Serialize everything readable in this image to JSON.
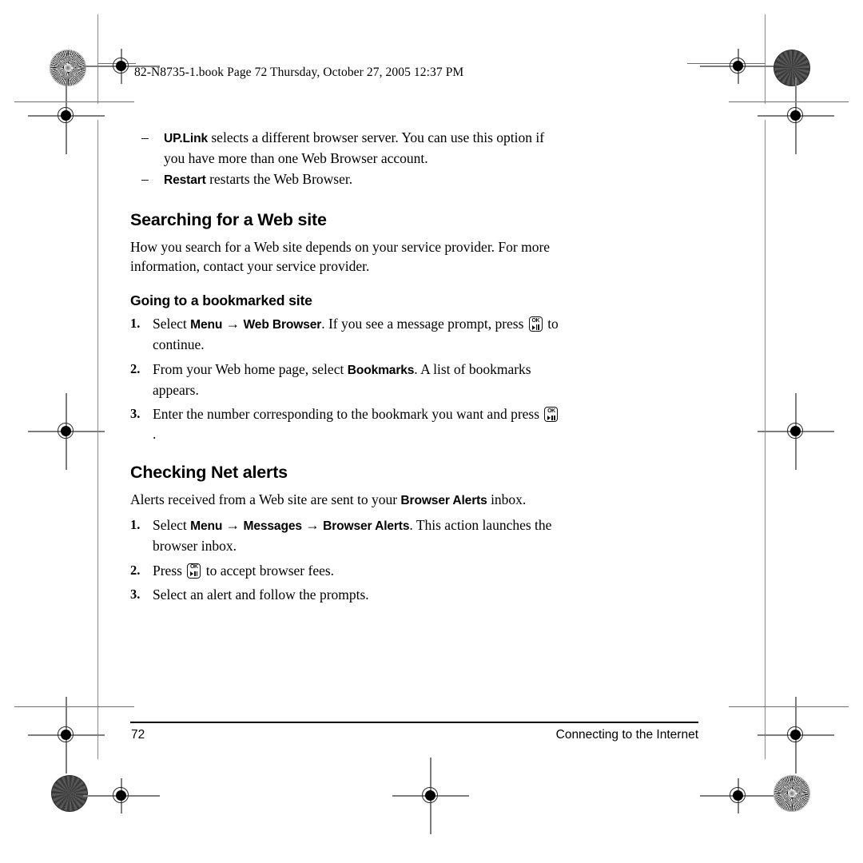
{
  "page": {
    "book_line": "82-N8735-1.book  Page 72  Thursday, October 27, 2005  12:37 PM",
    "number": "72",
    "footer_title": "Connecting to the Internet"
  },
  "dash_items": [
    {
      "dash": "–",
      "term": "UP.Link",
      "text": " selects a different browser server. You can use this option if you have more than one Web Browser account."
    },
    {
      "dash": "–",
      "term": "Restart",
      "text": " restarts the Web Browser."
    }
  ],
  "sections": [
    {
      "heading": "Searching for a Web site",
      "body": "How you search for a Web site depends on your service provider. For more information, contact your service provider.",
      "subheading": "Going to a bookmarked site",
      "steps": [
        {
          "num": "1.",
          "pre": "Select ",
          "term1": "Menu",
          "arrow1": " → ",
          "term2": "Web Browser",
          "mid": ". If you see a message prompt, press ",
          "icon": "ok-playpause-key-icon",
          "post": " to continue."
        },
        {
          "num": "2.",
          "pre": "From your Web home page, select ",
          "term1": "Bookmarks",
          "mid": ". A list of bookmarks appears."
        },
        {
          "num": "3.",
          "pre": "Enter the number corresponding to the bookmark you want and press ",
          "icon": "ok-playpause-key-icon",
          "post": "."
        }
      ]
    },
    {
      "heading": "Checking Net alerts",
      "body_pre": "Alerts received from a Web site are sent to your ",
      "body_term": "Browser Alerts",
      "body_post": " inbox.",
      "steps": [
        {
          "num": "1.",
          "pre": "Select ",
          "term1": "Menu",
          "arrow1": " → ",
          "term2": "Messages",
          "arrow2": " → ",
          "term3": "Browser Alerts",
          "mid": ". This action launches the browser inbox."
        },
        {
          "num": "2.",
          "pre": "Press ",
          "icon": "ok-playpause-key-icon",
          "post": " to accept browser fees."
        },
        {
          "num": "3.",
          "pre": "Select an alert and follow the prompts."
        }
      ]
    }
  ],
  "key_icon": {
    "ok_label": "OK",
    "play_glyph": "play-triangle",
    "pause_glyph": "pause-bars"
  },
  "press_marks": {
    "registration": "registration-bullseye",
    "starburst": "starburst-resolution-target",
    "halftone": "halftone-density-target",
    "colors": {
      "ink": "#000000",
      "trim_rule": "#8a8a8a"
    }
  }
}
